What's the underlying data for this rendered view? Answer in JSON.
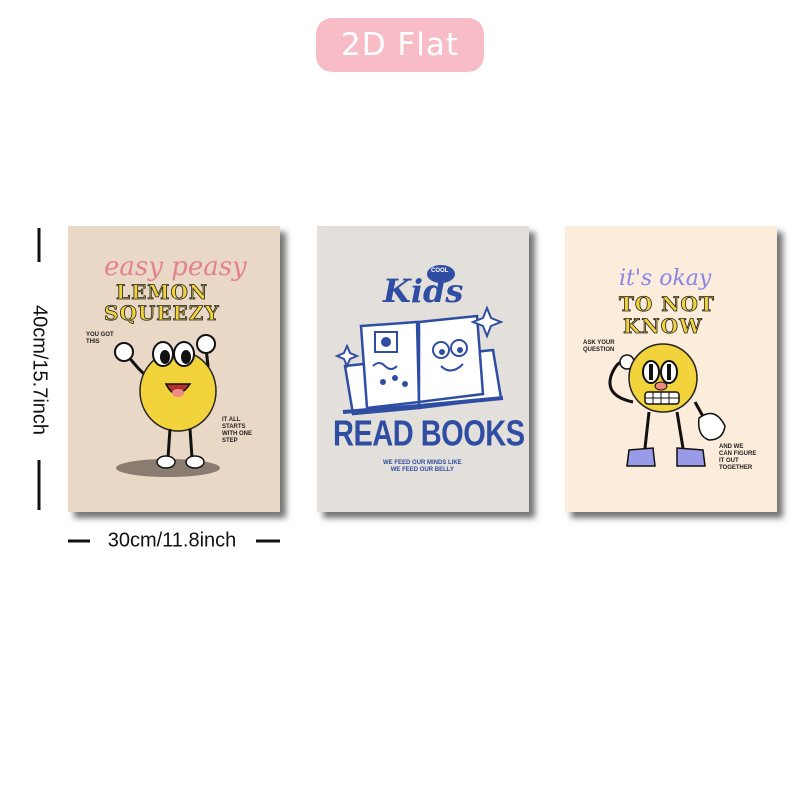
{
  "badge": {
    "label": "2D Flat",
    "color": "#f7bcc6"
  },
  "dimensions": {
    "height_label": "40cm/15.7inch",
    "width_label": "30cm/11.8inch"
  },
  "posters": [
    {
      "script_line": "easy peasy",
      "headline_1": "LEMON",
      "headline_2": "SQUEEZY",
      "note_left": "YOU GOT\nTHIS",
      "note_right": "IT ALL\nSTARTS\nWITH ONE\nSTEP",
      "background": "#ead8c7",
      "accent": "#f2d33b"
    },
    {
      "badge": "COOL",
      "script_line": "Kids",
      "headline": "READ BOOKS",
      "subline": "WE FEED OUR MINDS LIKE\nWE FEED OUR BELLY",
      "background": "#e3dfda",
      "accent": "#2f4ea3"
    },
    {
      "script_line": "it's okay",
      "headline_1": "TO NOT",
      "headline_2": "KNOW",
      "note_left": "ASK YOUR\nQUESTION",
      "note_right": "AND WE\nCAN FIGURE\nIT OUT\nTOGETHER",
      "background": "#fbecdc",
      "accent": "#f2d33b"
    }
  ]
}
